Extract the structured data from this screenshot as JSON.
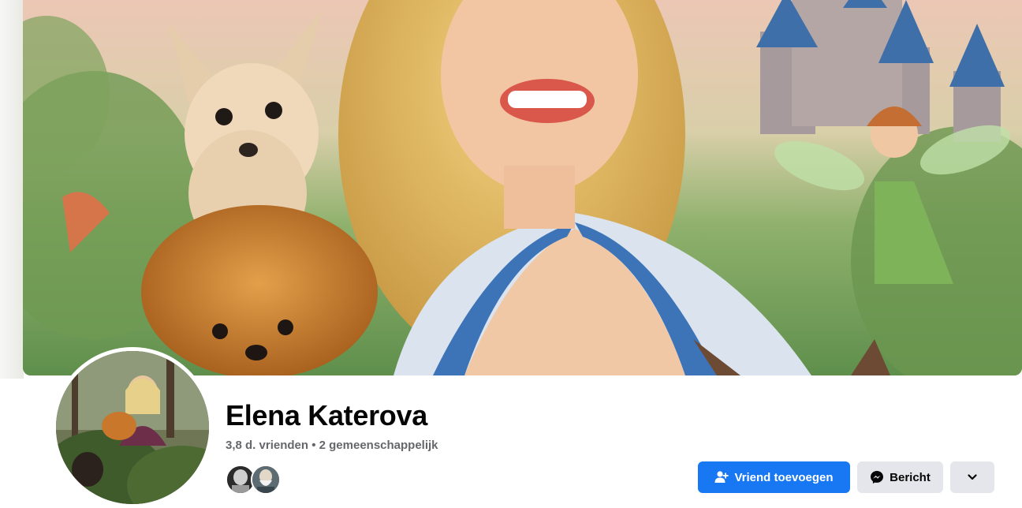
{
  "profile": {
    "name": "Elena Katerova",
    "stats": "3,8 d. vrienden • 2 gemeenschappelijk"
  },
  "mutual_friends": [
    {
      "icon": "mutual-friend-avatar-1"
    },
    {
      "icon": "mutual-friend-avatar-2"
    }
  ],
  "actions": {
    "add_friend_label": "Vriend toevoegen",
    "add_friend_icon": "add-person-icon",
    "message_label": "Bericht",
    "message_icon": "messenger-icon",
    "more_icon": "chevron-down-icon"
  },
  "colors": {
    "primary": "#1877f2",
    "secondary_bg": "#e4e6eb",
    "text": "#050505",
    "muted": "#65676b"
  }
}
